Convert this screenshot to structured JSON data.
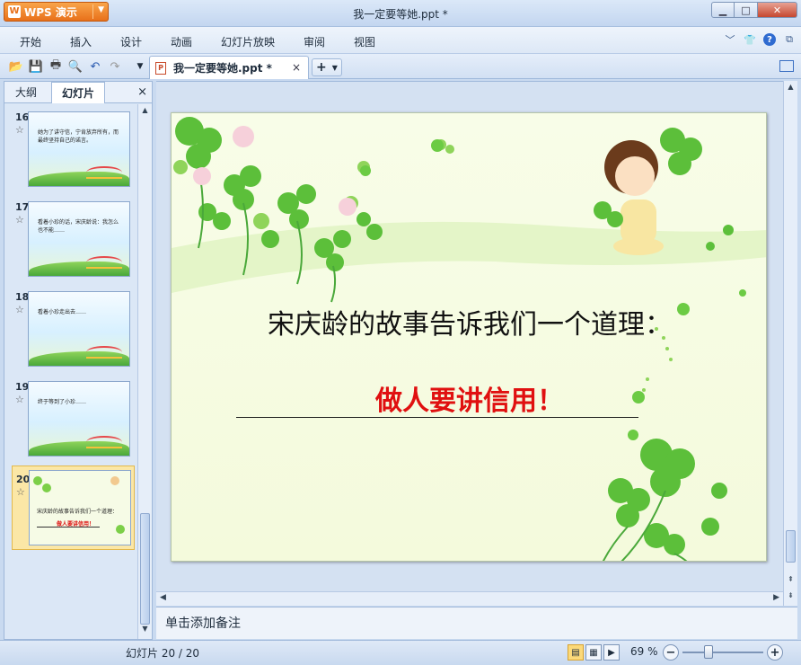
{
  "app": {
    "logo_label": "WPS 演示",
    "window_title": "我一定要等她.ppt *"
  },
  "menu": {
    "items": [
      "开始",
      "插入",
      "设计",
      "动画",
      "幻灯片放映",
      "审阅",
      "视图"
    ]
  },
  "doc_tab": {
    "label": "我一定要等她.ppt *",
    "close": "×"
  },
  "left_panel": {
    "tabs": [
      "大纲",
      "幻灯片"
    ],
    "close": "×",
    "slides": [
      {
        "number": "16",
        "text": "她为了讲守信，宁肯放弃所有，而最终坚持自己的诺言。"
      },
      {
        "number": "17",
        "text": "看着小珍的话，宋庆龄说：我怎么也不能……"
      },
      {
        "number": "18",
        "text": "看着小珍走出去……"
      },
      {
        "number": "19",
        "text": "终于等到了小珍……"
      },
      {
        "number": "20",
        "line1": "宋庆龄的故事告诉我们一个道理：",
        "line2": "做人要讲信用！"
      }
    ]
  },
  "slide": {
    "title": "宋庆龄的故事告诉我们一个道理：",
    "subtitle": "做人要讲信用！"
  },
  "notes": {
    "placeholder": "单击添加备注"
  },
  "status": {
    "slide_counter": "幻灯片 20 / 20",
    "zoom": "69 %",
    "zoom_value": 69
  }
}
